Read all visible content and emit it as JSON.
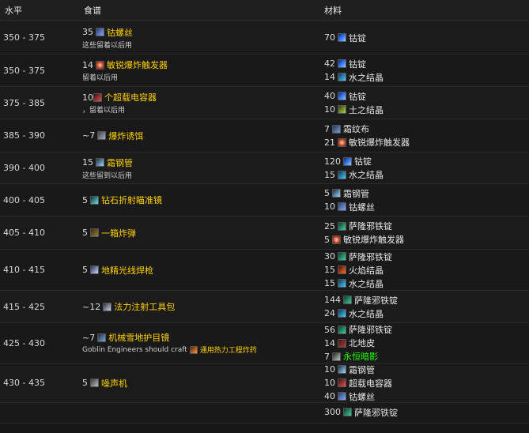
{
  "headers": {
    "level": "水平",
    "recipe": "食谱",
    "materials": "材料"
  },
  "rows": [
    {
      "level": "350 - 375",
      "recipe": {
        "qty": "35",
        "icon": "cobalt-bolt-icon",
        "icon_class": "cobalt-bolt",
        "name": "钴螺丝",
        "note": "这些留着以后用"
      },
      "materials": [
        {
          "qty": "70",
          "icon": "cobalt-bar-icon",
          "icon_class": "cobalt-bar",
          "name": "钴锭"
        }
      ]
    },
    {
      "level": "350 - 375",
      "recipe": {
        "qty": "14",
        "icon": "trigger-icon",
        "icon_class": "trigger",
        "name": "敏锐爆炸触发器",
        "note": "留着以后用"
      },
      "materials": [
        {
          "qty": "42",
          "icon": "cobalt-bar-icon",
          "icon_class": "cobalt-bar",
          "name": "钴锭"
        },
        {
          "qty": "14",
          "icon": "water-icon",
          "icon_class": "water",
          "name": "水之结晶"
        }
      ]
    },
    {
      "level": "375 - 385",
      "recipe": {
        "qty": "10",
        "icon": "capacitor-icon",
        "icon_class": "capacitor",
        "name": "个超载电容器",
        "note": "，留着以后用",
        "tight": true
      },
      "materials": [
        {
          "qty": "40",
          "icon": "cobalt-bar-icon",
          "icon_class": "cobalt-bar",
          "name": "钴锭"
        },
        {
          "qty": "10",
          "icon": "earth-icon",
          "icon_class": "earth",
          "name": "土之结晶"
        }
      ]
    },
    {
      "level": "385 - 390",
      "recipe": {
        "qty": "~7",
        "icon": "bait-icon",
        "icon_class": "bait",
        "name": "爆炸诱饵",
        "note": ""
      },
      "materials": [
        {
          "qty": "7",
          "icon": "cloth-icon",
          "icon_class": "cloth",
          "name": "霜纹布"
        },
        {
          "qty": "21",
          "icon": "trigger-icon",
          "icon_class": "trigger",
          "name": "敏锐爆炸触发器"
        }
      ]
    },
    {
      "level": "390 - 400",
      "recipe": {
        "qty": "15",
        "icon": "frost-tube-icon",
        "icon_class": "frost",
        "name": "霜钢管",
        "note": "这些留到以后用"
      },
      "materials": [
        {
          "qty": "120",
          "icon": "cobalt-bar-icon",
          "icon_class": "cobalt-bar",
          "name": "钴锭"
        },
        {
          "qty": "15",
          "icon": "water-icon",
          "icon_class": "water",
          "name": "水之结晶"
        }
      ]
    },
    {
      "level": "400 - 405",
      "recipe": {
        "qty": "5",
        "icon": "scope-icon",
        "icon_class": "scope",
        "name": "钻石折射瞄准镜",
        "note": ""
      },
      "materials": [
        {
          "qty": "5",
          "icon": "frost-tube-icon",
          "icon_class": "frost",
          "name": "霜钢管"
        },
        {
          "qty": "10",
          "icon": "cobalt-bolt-icon",
          "icon_class": "cobalt-bolt",
          "name": "钴螺丝"
        }
      ]
    },
    {
      "level": "405 - 410",
      "recipe": {
        "qty": "5",
        "icon": "box-icon",
        "icon_class": "box",
        "name": "一箱炸弹",
        "note": ""
      },
      "materials": [
        {
          "qty": "25",
          "icon": "saronite-bar-icon",
          "icon_class": "saronite",
          "name": "萨隆邪铁锭"
        },
        {
          "qty": "5",
          "icon": "trigger-icon",
          "icon_class": "trigger",
          "name": "敏锐爆炸触发器"
        }
      ]
    },
    {
      "level": "410 - 415",
      "recipe": {
        "qty": "5",
        "icon": "torch-icon",
        "icon_class": "torch",
        "name": "地精光线焊枪",
        "note": ""
      },
      "materials": [
        {
          "qty": "30",
          "icon": "saronite-bar-icon",
          "icon_class": "saronite",
          "name": "萨隆邪铁锭"
        },
        {
          "qty": "15",
          "icon": "fire-icon",
          "icon_class": "fire",
          "name": "火焰结晶"
        },
        {
          "qty": "15",
          "icon": "water-icon",
          "icon_class": "water",
          "name": "水之结晶"
        }
      ]
    },
    {
      "level": "415 - 425",
      "recipe": {
        "qty": "~12",
        "icon": "kit-icon",
        "icon_class": "kit",
        "name": "法力注射工具包",
        "note": ""
      },
      "materials": [
        {
          "qty": "144",
          "icon": "saronite-bar-icon",
          "icon_class": "saronite",
          "name": "萨隆邪铁锭"
        },
        {
          "qty": "24",
          "icon": "water-icon",
          "icon_class": "water",
          "name": "水之结晶"
        }
      ]
    },
    {
      "level": "425 - 430",
      "recipe": {
        "qty": "~7",
        "icon": "goggles-icon",
        "icon_class": "goggles",
        "name": "机械雪地护目镜",
        "note": "Goblin Engineers should craft",
        "note_link": "通用热力工程炸药",
        "note_icon": "explosive-icon"
      },
      "materials": [
        {
          "qty": "56",
          "icon": "saronite-bar-icon",
          "icon_class": "saronite",
          "name": "萨隆邪铁锭"
        },
        {
          "qty": "14",
          "icon": "borean-leather-icon",
          "icon_class": "borean",
          "name": "北地皮"
        },
        {
          "qty": "7",
          "icon": "eternal-shadow-icon",
          "icon_class": "shadow",
          "name": "永恒暗影",
          "color": "green"
        }
      ]
    },
    {
      "level": "430 - 435",
      "recipe": {
        "qty": "5",
        "icon": "noise-machine-icon",
        "icon_class": "noise",
        "name": "噪声机",
        "note": ""
      },
      "materials": [
        {
          "qty": "10",
          "icon": "frost-tube-icon",
          "icon_class": "frost",
          "name": "霜钢管"
        },
        {
          "qty": "10",
          "icon": "capacitor-icon",
          "icon_class": "capacitor",
          "name": "超载电容器"
        },
        {
          "qty": "40",
          "icon": "cobalt-bolt-icon",
          "icon_class": "cobalt-bolt",
          "name": "钴螺丝"
        }
      ]
    },
    {
      "level": "",
      "recipe": {
        "qty": "",
        "icon": "",
        "icon_class": "",
        "name": "",
        "note": ""
      },
      "materials": [
        {
          "qty": "300",
          "icon": "saronite-bar-icon",
          "icon_class": "saronite",
          "name": "萨隆邪铁锭"
        }
      ]
    }
  ]
}
